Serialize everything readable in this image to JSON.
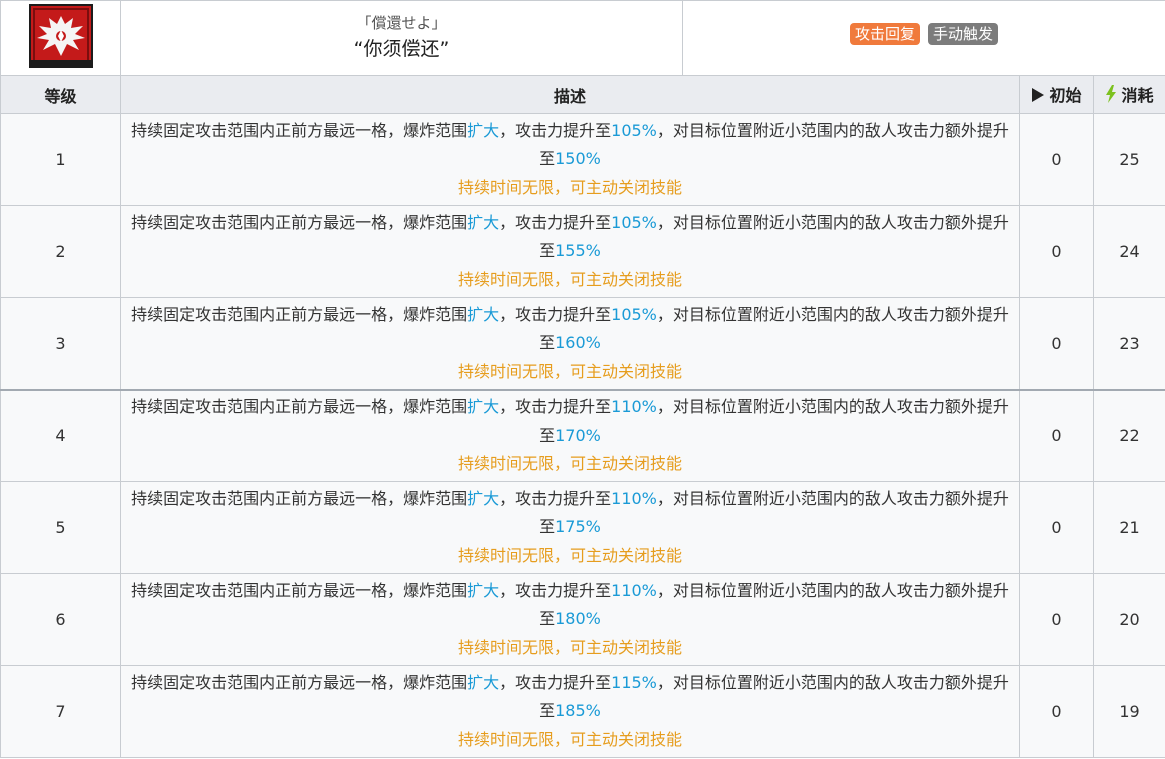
{
  "skill": {
    "icon": "winged-red-emblem-icon",
    "name_jp": "「償還せよ」",
    "name_cn": "“你须偿还”",
    "tags": [
      {
        "label": "攻击回复",
        "color": "#f07a3c"
      },
      {
        "label": "手动触发",
        "color": "#7c7c7c"
      }
    ]
  },
  "table": {
    "headers": {
      "level": "等级",
      "description": "描述",
      "initial": "初始",
      "cost": "消耗",
      "initial_icon": "play-triangle-icon",
      "cost_icon": "lightning-bolt-icon"
    },
    "desc_parts": {
      "p1": "持续固定攻击范围内正前方最远一格，爆炸范围",
      "range": "扩大",
      "p2": "，攻击力提升至",
      "p3": "，对目标位置附近小范围内的敌人攻击力额外提升至",
      "duration": "持续时间无限，可主动关闭技能"
    },
    "rows": [
      {
        "level": "1",
        "atk": "105%",
        "bonus": "150%",
        "initial": "0",
        "cost": "25"
      },
      {
        "level": "2",
        "atk": "105%",
        "bonus": "155%",
        "initial": "0",
        "cost": "24"
      },
      {
        "level": "3",
        "atk": "105%",
        "bonus": "160%",
        "initial": "0",
        "cost": "23"
      },
      {
        "level": "4",
        "atk": "110%",
        "bonus": "170%",
        "initial": "0",
        "cost": "22"
      },
      {
        "level": "5",
        "atk": "110%",
        "bonus": "175%",
        "initial": "0",
        "cost": "21"
      },
      {
        "level": "6",
        "atk": "110%",
        "bonus": "180%",
        "initial": "0",
        "cost": "20"
      },
      {
        "level": "7",
        "atk": "115%",
        "bonus": "185%",
        "initial": "0",
        "cost": "19"
      }
    ]
  },
  "colors": {
    "highlight_blue": "#1a9ad6",
    "duration_orange": "#e69d1e",
    "header_bg": "#eaecf0",
    "row_bg": "#f8f9fa",
    "cost_icon_green": "#7cc11f"
  }
}
